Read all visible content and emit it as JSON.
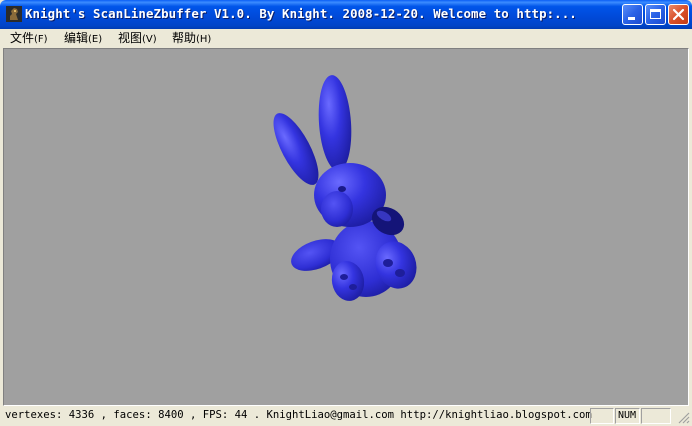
{
  "window": {
    "title": "Knight's ScanLineZbuffer V1.0. By Knight. 2008-12-20.  Welcome to http:..."
  },
  "menu": {
    "items": [
      {
        "label": "文件",
        "accel": "(F)"
      },
      {
        "label": "编辑",
        "accel": "(E)"
      },
      {
        "label": "视图",
        "accel": "(V)"
      },
      {
        "label": "帮助",
        "accel": "(H)"
      }
    ]
  },
  "viewport": {
    "background": "#a0a0a0",
    "model_color": "#3636e0",
    "icon": "bunny-model"
  },
  "status": {
    "text": "vertexes: 4336 , faces: 8400 , FPS: 44 .   KnightLiao@gmail.com   http://knightliao.blogspot.com",
    "num_indicator": "NUM",
    "empty_indicator_1": "",
    "empty_indicator_2": ""
  },
  "icons": {
    "app": "knight-app-icon",
    "minimize": "minimize-icon",
    "maximize": "maximize-icon",
    "close": "close-icon"
  }
}
